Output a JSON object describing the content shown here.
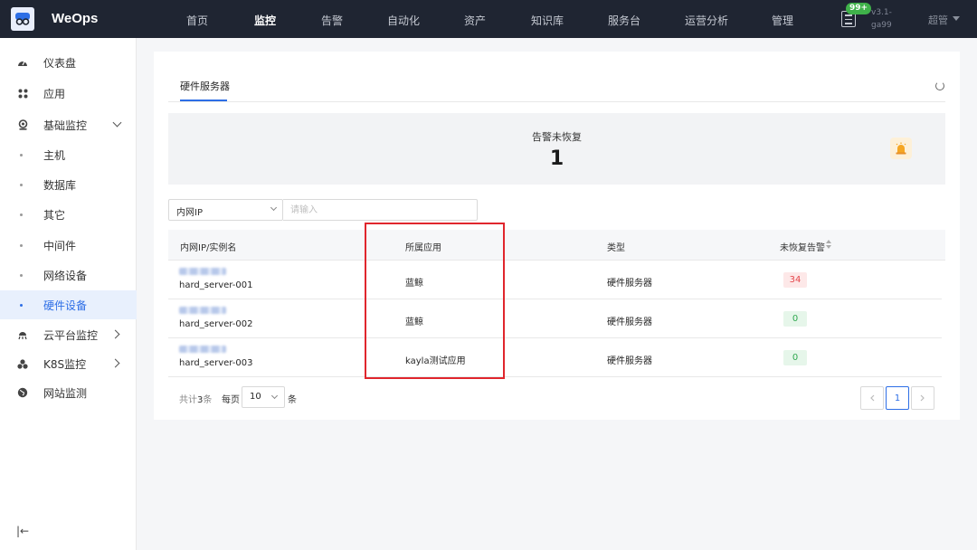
{
  "topbar": {
    "brand": "WeOps",
    "nav": [
      "首页",
      "监控",
      "告警",
      "自动化",
      "资产",
      "知识库",
      "服务台",
      "运营分析",
      "管理"
    ],
    "active_nav": "监控",
    "badge": "99+",
    "version_line1": "v3.1-",
    "version_line2": "ga99",
    "user": "超管"
  },
  "sidebar": {
    "items": [
      {
        "label": "仪表盘",
        "icon": "dashboard-icon"
      },
      {
        "label": "应用",
        "icon": "apps-icon"
      },
      {
        "label": "基础监控",
        "icon": "monitor-icon",
        "expanded": true
      },
      {
        "label": "主机"
      },
      {
        "label": "数据库"
      },
      {
        "label": "其它"
      },
      {
        "label": "中间件"
      },
      {
        "label": "网络设备"
      },
      {
        "label": "硬件设备",
        "active": true
      },
      {
        "label": "云平台监控",
        "icon": "cloud-icon"
      },
      {
        "label": "K8S监控",
        "icon": "k8s-icon"
      },
      {
        "label": "网站监测",
        "icon": "globe-icon"
      }
    ],
    "collapse": "|←"
  },
  "main": {
    "tab": "硬件服务器",
    "stat": {
      "label": "告警未恢复",
      "value": "1"
    },
    "filter": {
      "field": "内网IP",
      "placeholder": "请输入"
    },
    "table": {
      "columns": [
        "内网IP/实例名",
        "所属应用",
        "类型",
        "未恢复告警"
      ],
      "rows": [
        {
          "instance": "hard_server-001",
          "app": "蓝鲸",
          "type": "硬件服务器",
          "alerts": "34",
          "status": "red"
        },
        {
          "instance": "hard_server-002",
          "app": "蓝鲸",
          "type": "硬件服务器",
          "alerts": "0",
          "status": "green"
        },
        {
          "instance": "hard_server-003",
          "app": "kayla测试应用",
          "type": "硬件服务器",
          "alerts": "0",
          "status": "green"
        }
      ]
    },
    "pagination": {
      "total_prefix": "共计",
      "total": "3",
      "total_suffix": "条",
      "per_page": "每页",
      "page_size": "10",
      "unit": "条",
      "current": "1"
    }
  },
  "colors": {
    "accent": "#2d6ee6",
    "topbar": "#1f2532",
    "highlight": "#e0262d"
  }
}
